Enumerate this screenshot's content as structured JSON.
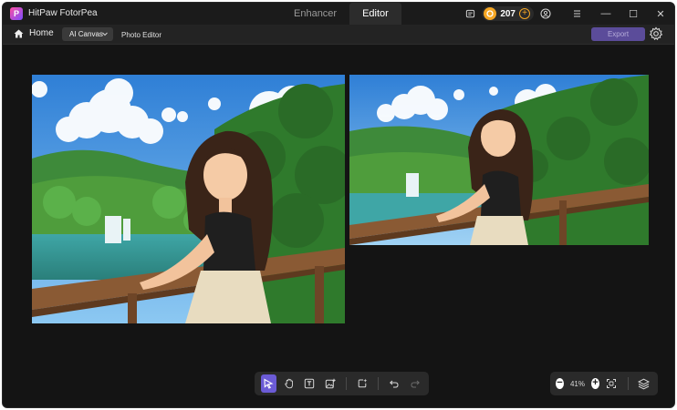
{
  "app": {
    "title": "HitPaw FotorPea",
    "logo_glyph": "P"
  },
  "mode_tabs": [
    {
      "label": "Enhancer",
      "active": false
    },
    {
      "label": "Editor",
      "active": true
    }
  ],
  "titlebar": {
    "credits": "207",
    "icons": [
      "message-icon",
      "coin-icon",
      "add-credits-icon",
      "account-icon",
      "menu-icon"
    ],
    "window_controls": {
      "minimize": "—",
      "maximize": "☐",
      "close": "✕"
    }
  },
  "toolbar": {
    "home_label": "Home",
    "canvas_select": "AI Canvas",
    "breadcrumb": "Photo Editor",
    "export_label": "Export"
  },
  "canvas": {
    "images": [
      {
        "name": "generated-image-1",
        "description_icon": "anime-girl-waterfall"
      },
      {
        "name": "generated-image-2",
        "description_icon": "anime-girl-waterfall"
      }
    ]
  },
  "tools": [
    {
      "name": "select-tool",
      "active": true
    },
    {
      "name": "hand-tool",
      "active": false
    },
    {
      "name": "text-tool",
      "active": false
    },
    {
      "name": "add-image-tool",
      "active": false
    },
    {
      "name": "ai-generate-tool",
      "active": false
    },
    {
      "name": "undo-button",
      "active": false
    },
    {
      "name": "redo-button",
      "active": false
    }
  ],
  "zoom": {
    "value": "41%",
    "minus": "−",
    "plus": "+"
  },
  "colors": {
    "accent": "#6b5bd6",
    "export": "#5b4c9a",
    "coin": "#f5a623",
    "background": "#151515"
  }
}
